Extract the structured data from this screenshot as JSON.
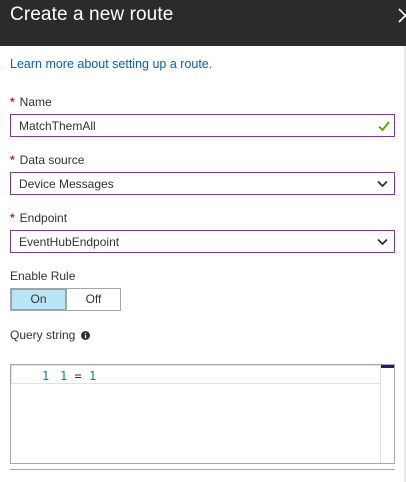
{
  "header": {
    "title": "Create a new route"
  },
  "learn_link": "Learn more about setting up a route.",
  "name_field": {
    "label": "Name",
    "required": "*",
    "value": "MatchThemAll"
  },
  "data_source": {
    "label": "Data source",
    "required": "*",
    "selected": "Device Messages"
  },
  "endpoint": {
    "label": "Endpoint",
    "required": "*",
    "selected": "EventHubEndpoint"
  },
  "enable_rule": {
    "label": "Enable Rule",
    "on_label": "On",
    "off_label": "Off",
    "selected": "On"
  },
  "query": {
    "label": "Query string",
    "line_number": "1",
    "code_lhs": "1",
    "code_op": "=",
    "code_rhs": "1"
  },
  "colors": {
    "header_bg": "#2b2b2b",
    "link": "#0063b1",
    "required": "#c4262e",
    "focus_border": "#7d3c8a",
    "toggle_on": "#b8e6f7",
    "check": "#57a300"
  },
  "icons": {
    "close": "close-icon",
    "valid": "check-icon",
    "dropdown": "chevron-down-icon",
    "info": "info-icon"
  }
}
